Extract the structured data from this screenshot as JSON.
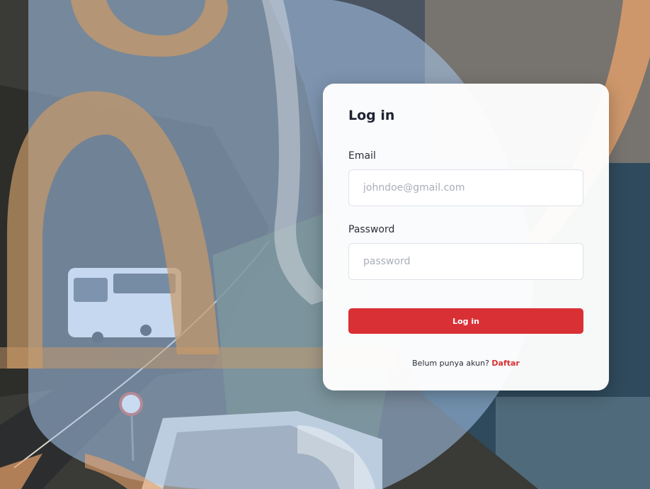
{
  "colors": {
    "accent": "#d93035",
    "overlay_blue": "#a8c8ef",
    "overlay_orange": "#e9a36a",
    "card_background": "#ffffff"
  },
  "login": {
    "title": "Log in",
    "email_label": "Email",
    "email_placeholder": "johndoe@gmail.com",
    "email_value": "",
    "password_label": "Password",
    "password_placeholder": "password",
    "password_value": "",
    "submit_label": "Log in",
    "signup_prompt": "Belum punya akun?",
    "signup_link": "Daftar"
  }
}
